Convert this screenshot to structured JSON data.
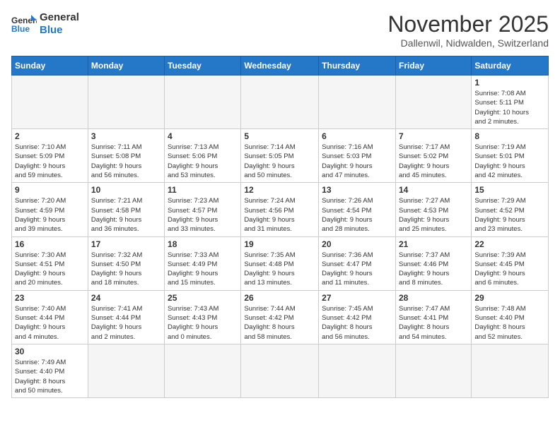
{
  "logo": {
    "text_general": "General",
    "text_blue": "Blue"
  },
  "header": {
    "month_year": "November 2025",
    "location": "Dallenwil, Nidwalden, Switzerland"
  },
  "weekdays": [
    "Sunday",
    "Monday",
    "Tuesday",
    "Wednesday",
    "Thursday",
    "Friday",
    "Saturday"
  ],
  "weeks": [
    [
      {
        "day": "",
        "info": ""
      },
      {
        "day": "",
        "info": ""
      },
      {
        "day": "",
        "info": ""
      },
      {
        "day": "",
        "info": ""
      },
      {
        "day": "",
        "info": ""
      },
      {
        "day": "",
        "info": ""
      },
      {
        "day": "1",
        "info": "Sunrise: 7:08 AM\nSunset: 5:11 PM\nDaylight: 10 hours\nand 2 minutes."
      }
    ],
    [
      {
        "day": "2",
        "info": "Sunrise: 7:10 AM\nSunset: 5:09 PM\nDaylight: 9 hours\nand 59 minutes."
      },
      {
        "day": "3",
        "info": "Sunrise: 7:11 AM\nSunset: 5:08 PM\nDaylight: 9 hours\nand 56 minutes."
      },
      {
        "day": "4",
        "info": "Sunrise: 7:13 AM\nSunset: 5:06 PM\nDaylight: 9 hours\nand 53 minutes."
      },
      {
        "day": "5",
        "info": "Sunrise: 7:14 AM\nSunset: 5:05 PM\nDaylight: 9 hours\nand 50 minutes."
      },
      {
        "day": "6",
        "info": "Sunrise: 7:16 AM\nSunset: 5:03 PM\nDaylight: 9 hours\nand 47 minutes."
      },
      {
        "day": "7",
        "info": "Sunrise: 7:17 AM\nSunset: 5:02 PM\nDaylight: 9 hours\nand 45 minutes."
      },
      {
        "day": "8",
        "info": "Sunrise: 7:19 AM\nSunset: 5:01 PM\nDaylight: 9 hours\nand 42 minutes."
      }
    ],
    [
      {
        "day": "9",
        "info": "Sunrise: 7:20 AM\nSunset: 4:59 PM\nDaylight: 9 hours\nand 39 minutes."
      },
      {
        "day": "10",
        "info": "Sunrise: 7:21 AM\nSunset: 4:58 PM\nDaylight: 9 hours\nand 36 minutes."
      },
      {
        "day": "11",
        "info": "Sunrise: 7:23 AM\nSunset: 4:57 PM\nDaylight: 9 hours\nand 33 minutes."
      },
      {
        "day": "12",
        "info": "Sunrise: 7:24 AM\nSunset: 4:56 PM\nDaylight: 9 hours\nand 31 minutes."
      },
      {
        "day": "13",
        "info": "Sunrise: 7:26 AM\nSunset: 4:54 PM\nDaylight: 9 hours\nand 28 minutes."
      },
      {
        "day": "14",
        "info": "Sunrise: 7:27 AM\nSunset: 4:53 PM\nDaylight: 9 hours\nand 25 minutes."
      },
      {
        "day": "15",
        "info": "Sunrise: 7:29 AM\nSunset: 4:52 PM\nDaylight: 9 hours\nand 23 minutes."
      }
    ],
    [
      {
        "day": "16",
        "info": "Sunrise: 7:30 AM\nSunset: 4:51 PM\nDaylight: 9 hours\nand 20 minutes."
      },
      {
        "day": "17",
        "info": "Sunrise: 7:32 AM\nSunset: 4:50 PM\nDaylight: 9 hours\nand 18 minutes."
      },
      {
        "day": "18",
        "info": "Sunrise: 7:33 AM\nSunset: 4:49 PM\nDaylight: 9 hours\nand 15 minutes."
      },
      {
        "day": "19",
        "info": "Sunrise: 7:35 AM\nSunset: 4:48 PM\nDaylight: 9 hours\nand 13 minutes."
      },
      {
        "day": "20",
        "info": "Sunrise: 7:36 AM\nSunset: 4:47 PM\nDaylight: 9 hours\nand 11 minutes."
      },
      {
        "day": "21",
        "info": "Sunrise: 7:37 AM\nSunset: 4:46 PM\nDaylight: 9 hours\nand 8 minutes."
      },
      {
        "day": "22",
        "info": "Sunrise: 7:39 AM\nSunset: 4:45 PM\nDaylight: 9 hours\nand 6 minutes."
      }
    ],
    [
      {
        "day": "23",
        "info": "Sunrise: 7:40 AM\nSunset: 4:44 PM\nDaylight: 9 hours\nand 4 minutes."
      },
      {
        "day": "24",
        "info": "Sunrise: 7:41 AM\nSunset: 4:44 PM\nDaylight: 9 hours\nand 2 minutes."
      },
      {
        "day": "25",
        "info": "Sunrise: 7:43 AM\nSunset: 4:43 PM\nDaylight: 9 hours\nand 0 minutes."
      },
      {
        "day": "26",
        "info": "Sunrise: 7:44 AM\nSunset: 4:42 PM\nDaylight: 8 hours\nand 58 minutes."
      },
      {
        "day": "27",
        "info": "Sunrise: 7:45 AM\nSunset: 4:42 PM\nDaylight: 8 hours\nand 56 minutes."
      },
      {
        "day": "28",
        "info": "Sunrise: 7:47 AM\nSunset: 4:41 PM\nDaylight: 8 hours\nand 54 minutes."
      },
      {
        "day": "29",
        "info": "Sunrise: 7:48 AM\nSunset: 4:40 PM\nDaylight: 8 hours\nand 52 minutes."
      }
    ],
    [
      {
        "day": "30",
        "info": "Sunrise: 7:49 AM\nSunset: 4:40 PM\nDaylight: 8 hours\nand 50 minutes."
      },
      {
        "day": "",
        "info": ""
      },
      {
        "day": "",
        "info": ""
      },
      {
        "day": "",
        "info": ""
      },
      {
        "day": "",
        "info": ""
      },
      {
        "day": "",
        "info": ""
      },
      {
        "day": "",
        "info": ""
      }
    ]
  ]
}
